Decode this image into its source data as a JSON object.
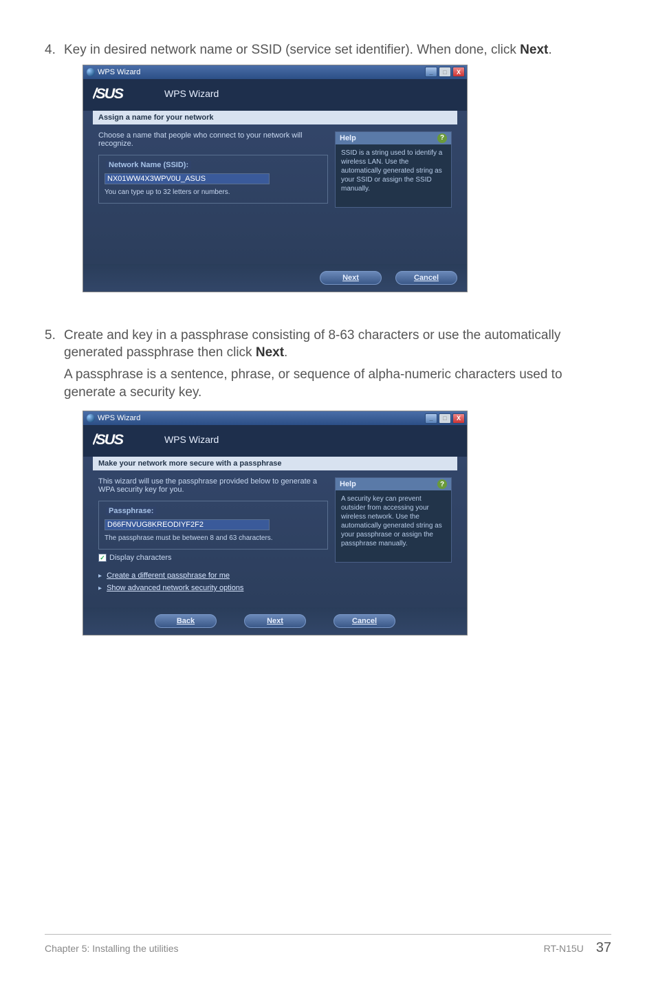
{
  "step4": {
    "num": "4.",
    "text_before": "Key in desired network name or SSID (service set identifier). When done, click ",
    "text_bold": "Next",
    "text_after": "."
  },
  "step5": {
    "num": "5.",
    "line1_before": "Create and key in a passphrase consisting of 8-63 characters or use the automatically generated passphrase then click ",
    "line1_bold": "Next",
    "line1_after": ".",
    "cont": "A passphrase is a sentence, phrase, or sequence of alpha-numeric characters used to generate a security key."
  },
  "dialog1": {
    "titlebar": "WPS Wizard",
    "brand_title": "WPS Wizard",
    "section": "Assign a name for your network",
    "desc": "Choose a name that people who connect to your network will recognize.",
    "legend": "Network Name (SSID):",
    "input": "NX01WW4X3WPV0U_ASUS",
    "hint": "You can type up to 32 letters or numbers.",
    "help_title": "Help",
    "help_body": "SSID is a string used to identify a wireless LAN. Use the automatically generated string as your SSID or assign the SSID manually.",
    "btn_next": "Next",
    "btn_cancel": "Cancel",
    "win_min": "_",
    "win_max": "□",
    "win_close": "X"
  },
  "dialog2": {
    "titlebar": "WPS Wizard",
    "brand_title": "WPS Wizard",
    "section": "Make your network more secure with a passphrase",
    "desc": "This wizard will use the passphrase provided below to generate a WPA security key for you.",
    "legend": "Passphrase:",
    "input": "D66FNVUG8KREODIYF2F2",
    "hint": "The passphrase must be between 8 and 63 characters.",
    "checkbox_label": "Display characters",
    "link1": "Create a different passphrase for me",
    "link2": "Show advanced network security options",
    "help_title": "Help",
    "help_body": "A security key can prevent outsider from accessing your wireless network. Use the automatically generated string as your passphrase or assign the passphrase manually.",
    "btn_back": "Back",
    "btn_next": "Next",
    "btn_cancel": "Cancel",
    "win_min": "_",
    "win_max": "□",
    "win_close": "X",
    "check_mark": "✓"
  },
  "footer": {
    "left": "Chapter 5: Installing the utilities",
    "model": "RT-N15U",
    "page": "37"
  },
  "brand": "/SUS"
}
